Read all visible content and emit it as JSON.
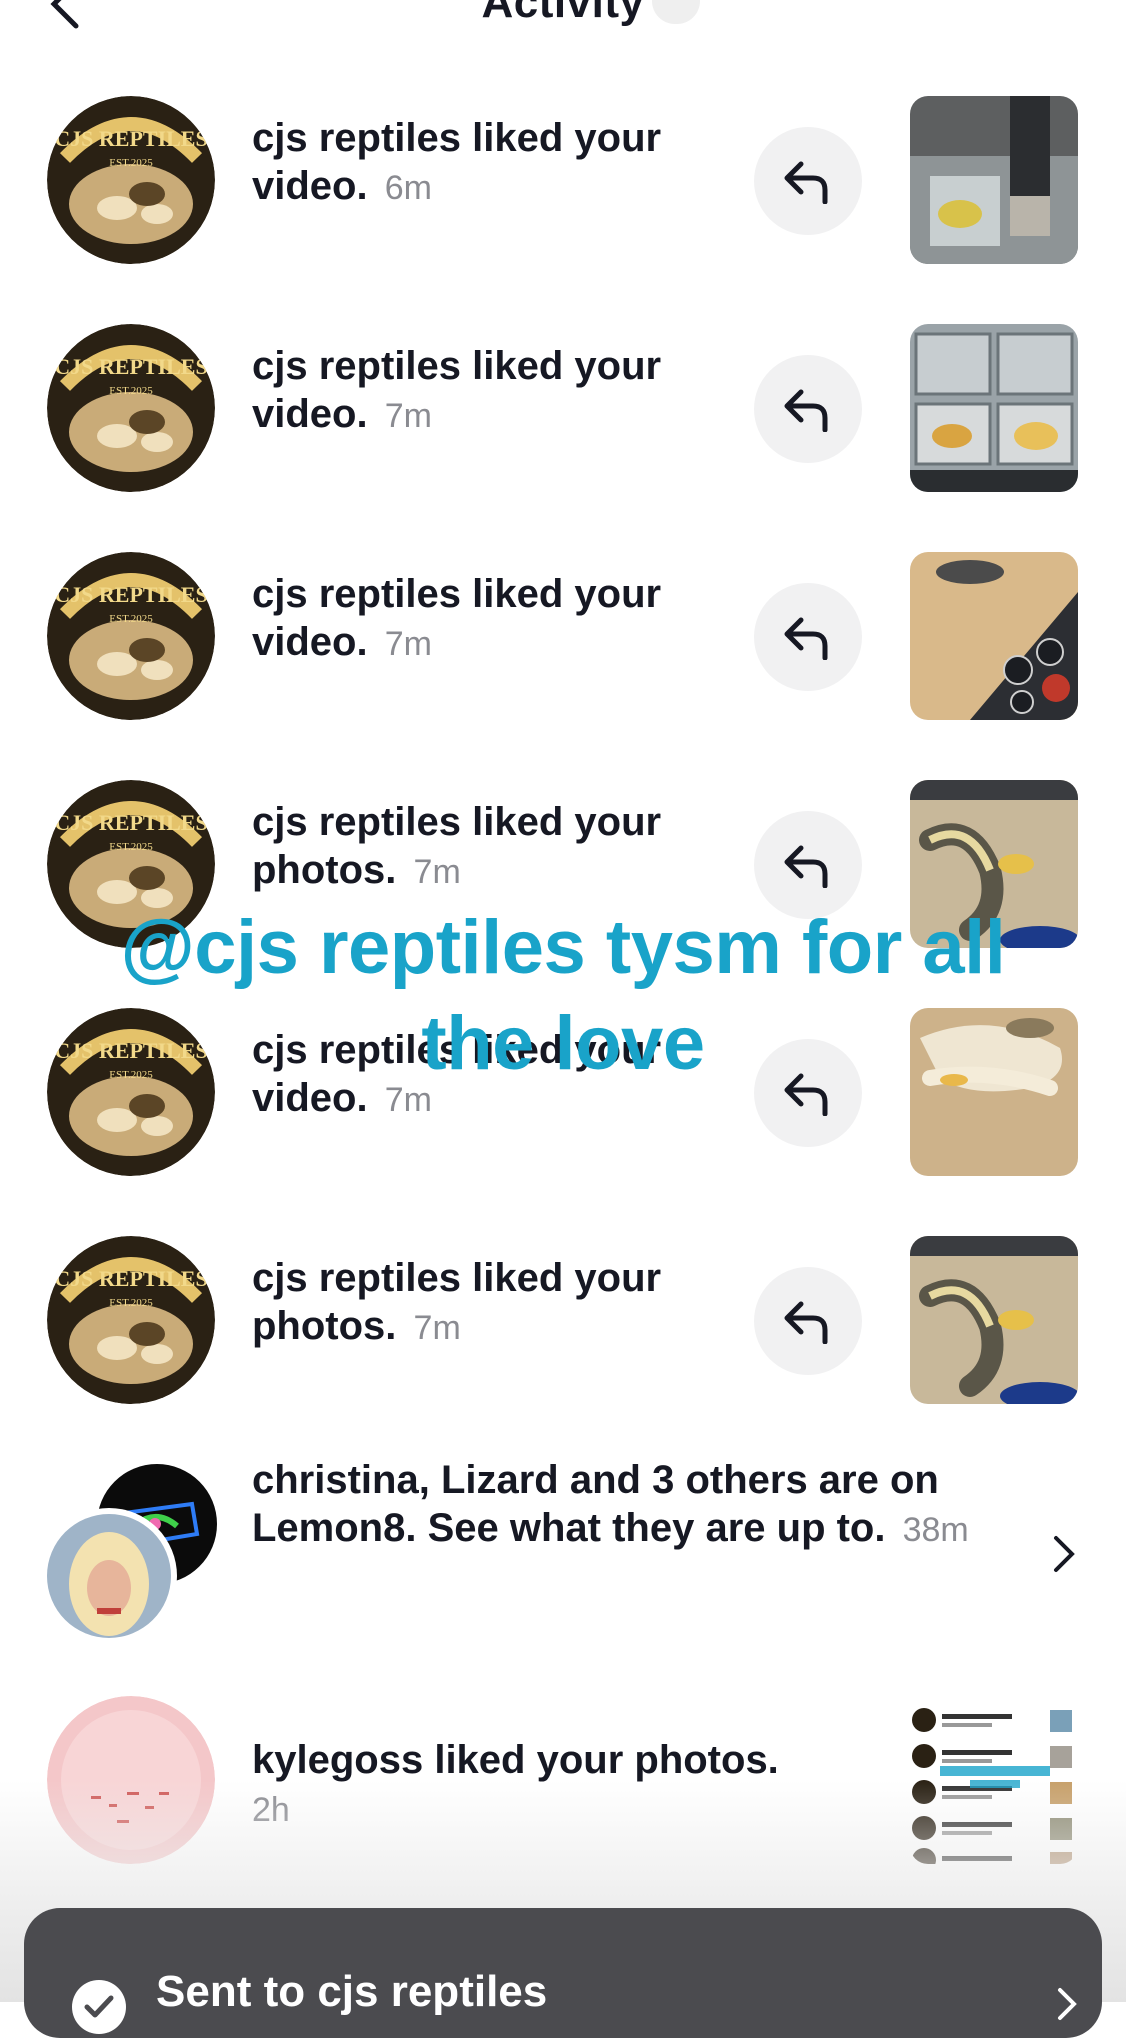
{
  "header": {
    "title": "Activity"
  },
  "notifications": [
    {
      "actor": "cjs reptiles",
      "text": "cjs reptiles liked your video.",
      "time": "6m"
    },
    {
      "actor": "cjs reptiles",
      "text": "cjs reptiles liked your video.",
      "time": "7m"
    },
    {
      "actor": "cjs reptiles",
      "text": "cjs reptiles liked your video.",
      "time": "7m"
    },
    {
      "actor": "cjs reptiles",
      "text": "cjs reptiles liked your photos.",
      "time": "7m"
    },
    {
      "actor": "cjs reptiles",
      "text": "cjs reptiles liked your video.",
      "time": "7m"
    },
    {
      "actor": "cjs reptiles",
      "text": "cjs reptiles liked your photos.",
      "time": "7m"
    },
    {
      "actor": "christina, Lizard",
      "text": "christina, Lizard and 3 others are on Lemon8. See what they are up to.",
      "time": "38m"
    },
    {
      "actor": "kylegoss",
      "text": "kylegoss liked your photos.",
      "time": "2h"
    }
  ],
  "avatar_logo": {
    "line1": "CJS REPTILES",
    "line2": "EST.2025"
  },
  "overlay_caption": "@cjs reptiles tysm for all the love",
  "toast": {
    "text": "Sent to cjs reptiles"
  },
  "colors": {
    "caption": "#19a3c9",
    "toast_bg": "#4b4b4f",
    "time_gray": "#8a8b91"
  }
}
